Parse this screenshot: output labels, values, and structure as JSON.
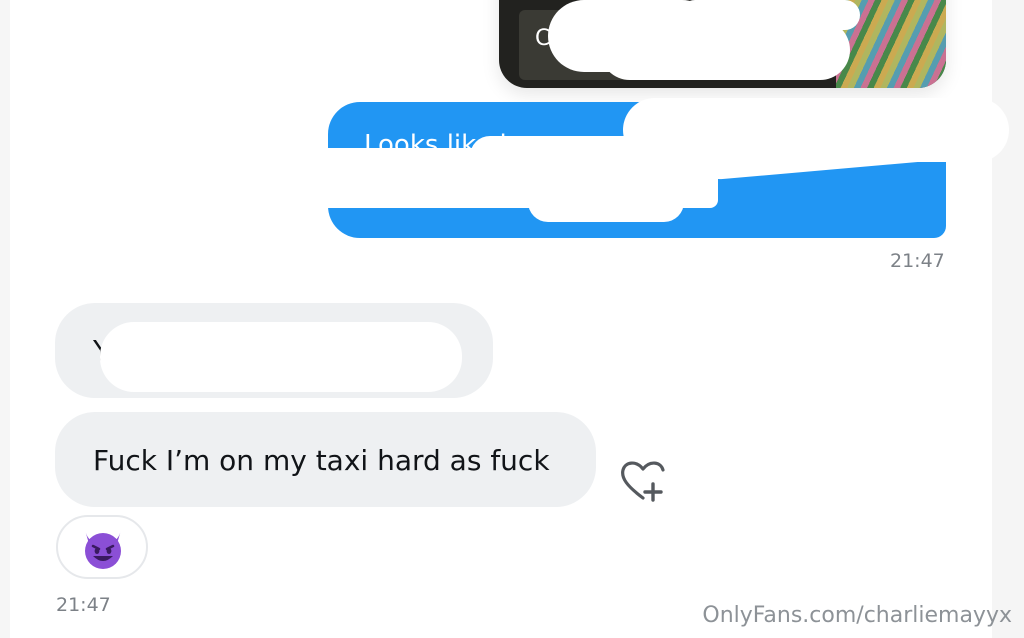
{
  "photo": {
    "mark": "C"
  },
  "sent_message": {
    "text": "Looks like i",
    "time": "21:47"
  },
  "received_messages": [
    {
      "text": "Y"
    },
    {
      "text": "Fuck I’m on my taxi hard as fuck"
    }
  ],
  "received_time": "21:47",
  "like_button_icon": "heart-plus-icon",
  "reaction": {
    "icon": "smiling-devil-emoji-icon"
  },
  "watermark": "OnlyFans.com/charliemayyx",
  "colors": {
    "sent_bubble": "#2196f3",
    "received_bubble": "#eef0f2",
    "time_text": "#7c8187",
    "reaction_purple": "#8b4fd6"
  }
}
